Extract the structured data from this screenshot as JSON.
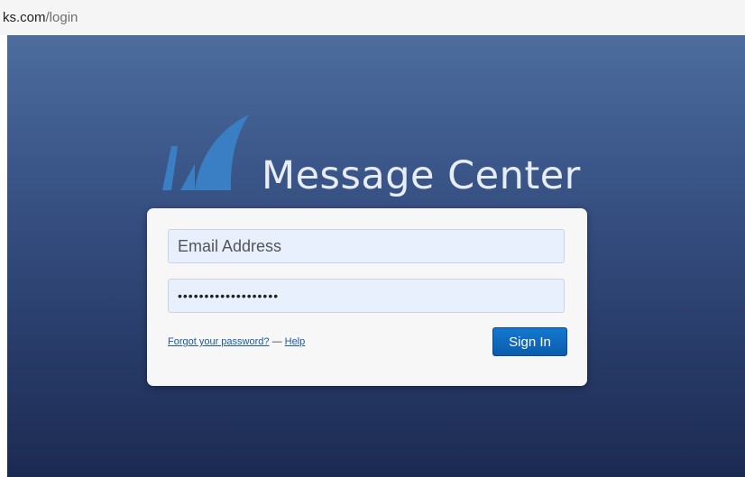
{
  "browser": {
    "url_host": "ks.com",
    "url_path": "/login"
  },
  "brand": {
    "logo_icon": "shark-fin-logo-icon",
    "app_title": "Message Center",
    "logo_color": "#3a7fc4"
  },
  "login_form": {
    "email_placeholder": "Email Address",
    "email_value": "",
    "password_value": "•••••••••••••••••••",
    "forgot_password_label": "Forgot your password?",
    "separator": "—",
    "help_label": "Help",
    "sign_in_label": "Sign In"
  },
  "colors": {
    "background_top": "#4d6d9f",
    "background_bottom": "#1c2a52",
    "input_fill": "#e8f0fe",
    "button_accent": "#0b5cab",
    "link": "#1a5aa8"
  }
}
